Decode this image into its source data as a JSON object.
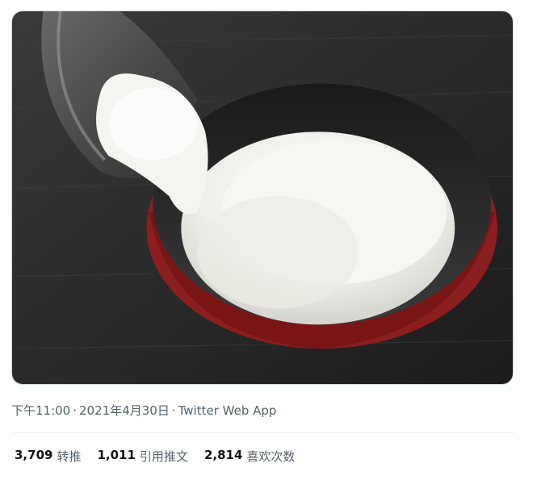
{
  "tweet": {
    "image_alt": "Rice poured from a glass bowl into a red and black lacquered bowl",
    "time": "下午11:00",
    "separator": "·",
    "date": "2021年4月30日",
    "source": "Twitter Web App"
  },
  "stats": [
    {
      "count": "3,709",
      "label": "转推"
    },
    {
      "count": "1,011",
      "label": "引用推文"
    },
    {
      "count": "2,814",
      "label": "喜欢次数"
    }
  ]
}
